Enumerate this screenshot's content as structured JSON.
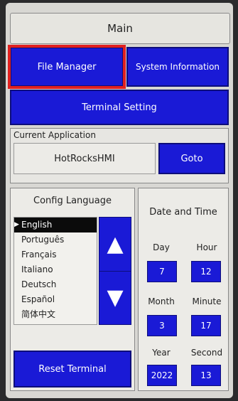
{
  "header": {
    "title": "Main"
  },
  "nav": {
    "file_manager": "File Manager",
    "system_information": "System Information",
    "terminal_setting": "Terminal Setting"
  },
  "current_application": {
    "label": "Current Application",
    "name": "HotRocksHMI",
    "goto_label": "Goto"
  },
  "language": {
    "title": "Config Language",
    "options": [
      "English",
      "Português",
      "Français",
      "Italiano",
      "Deutsch",
      "Español",
      "简体中文"
    ],
    "selected": "English",
    "up_icon": "triangle-up-icon",
    "down_icon": "triangle-down-icon"
  },
  "reset_label": "Reset Terminal",
  "datetime": {
    "title": "Date and Time",
    "day_label": "Day",
    "day": "7",
    "hour_label": "Hour",
    "hour": "12",
    "month_label": "Month",
    "month": "3",
    "minute_label": "Minute",
    "minute": "17",
    "year_label": "Year",
    "year": "2022",
    "second_label": "Second",
    "second": "13"
  },
  "colors": {
    "button_blue": "#1a1ad6",
    "highlight_red": "#e02020"
  }
}
